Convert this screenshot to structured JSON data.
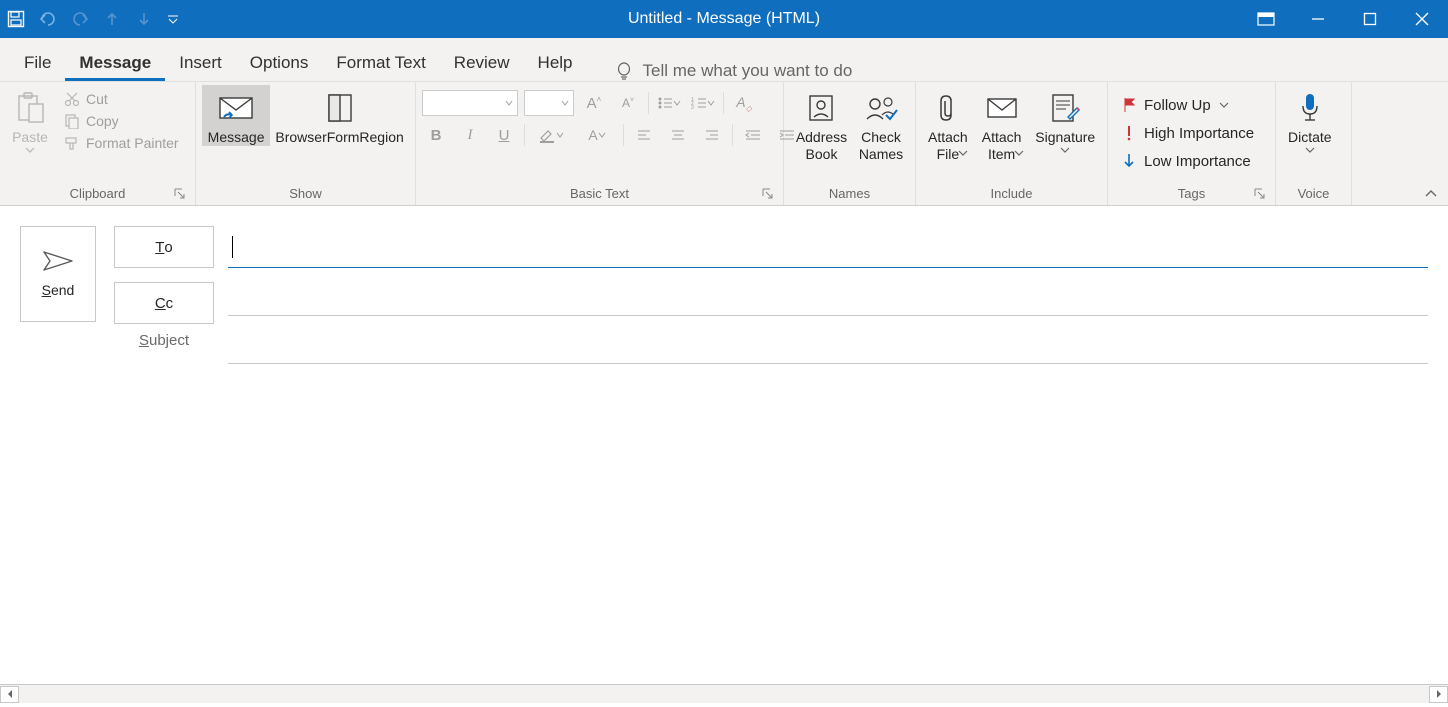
{
  "title": "Untitled  -  Message (HTML)",
  "tabs": {
    "file": "File",
    "message": "Message",
    "insert": "Insert",
    "options": "Options",
    "format_text": "Format Text",
    "review": "Review",
    "help": "Help"
  },
  "tellme": "Tell me what you want to do",
  "clipboard": {
    "paste": "Paste",
    "cut": "Cut",
    "copy": "Copy",
    "format_painter": "Format Painter",
    "label": "Clipboard"
  },
  "show": {
    "message": "Message",
    "browser": "BrowserFormRegion",
    "label": "Show"
  },
  "basic_text": {
    "font_name": "",
    "font_size": "",
    "label": "Basic Text"
  },
  "names": {
    "address_book": "Address\nBook",
    "check_names": "Check\nNames",
    "label": "Names"
  },
  "include": {
    "attach_file": "Attach\nFile",
    "attach_item": "Attach\nItem",
    "signature": "Signature",
    "label": "Include"
  },
  "tags": {
    "follow_up": "Follow Up",
    "high": "High Importance",
    "low": "Low Importance",
    "label": "Tags"
  },
  "voice": {
    "dictate": "Dictate",
    "label": "Voice"
  },
  "compose": {
    "send": "end",
    "send_prefix": "S",
    "to": "o",
    "to_prefix": "T",
    "cc": "c",
    "cc_prefix": "C",
    "subject": "ubject",
    "subject_prefix": "S",
    "to_value": "",
    "cc_value": "",
    "subject_value": ""
  }
}
